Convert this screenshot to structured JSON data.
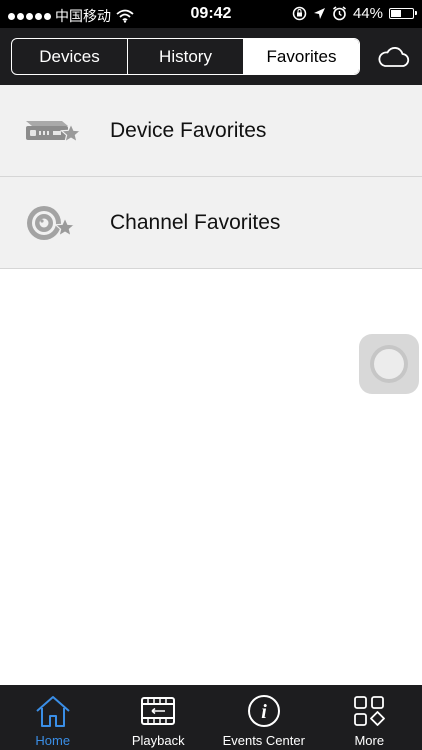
{
  "status_bar": {
    "carrier": "中国移动",
    "time": "09:42",
    "battery": "44%",
    "battery_level": 0.44
  },
  "header": {
    "tabs": [
      {
        "label": "Devices",
        "active": false
      },
      {
        "label": "History",
        "active": false
      },
      {
        "label": "Favorites",
        "active": true
      }
    ],
    "cloud_icon": "cloud-icon"
  },
  "favorites": {
    "items": [
      {
        "label": "Device Favorites",
        "icon": "device-star-icon"
      },
      {
        "label": "Channel Favorites",
        "icon": "camera-star-icon"
      }
    ]
  },
  "tab_bar": {
    "items": [
      {
        "label": "Home",
        "icon": "home-icon",
        "active": true
      },
      {
        "label": "Playback",
        "icon": "playback-icon",
        "active": false
      },
      {
        "label": "Events Center",
        "icon": "info-icon",
        "active": false
      },
      {
        "label": "More",
        "icon": "more-icon",
        "active": false
      }
    ]
  },
  "colors": {
    "bar_background": "#1d1d1f",
    "list_background": "#f1f1f1",
    "accent": "#3a8ee6"
  }
}
